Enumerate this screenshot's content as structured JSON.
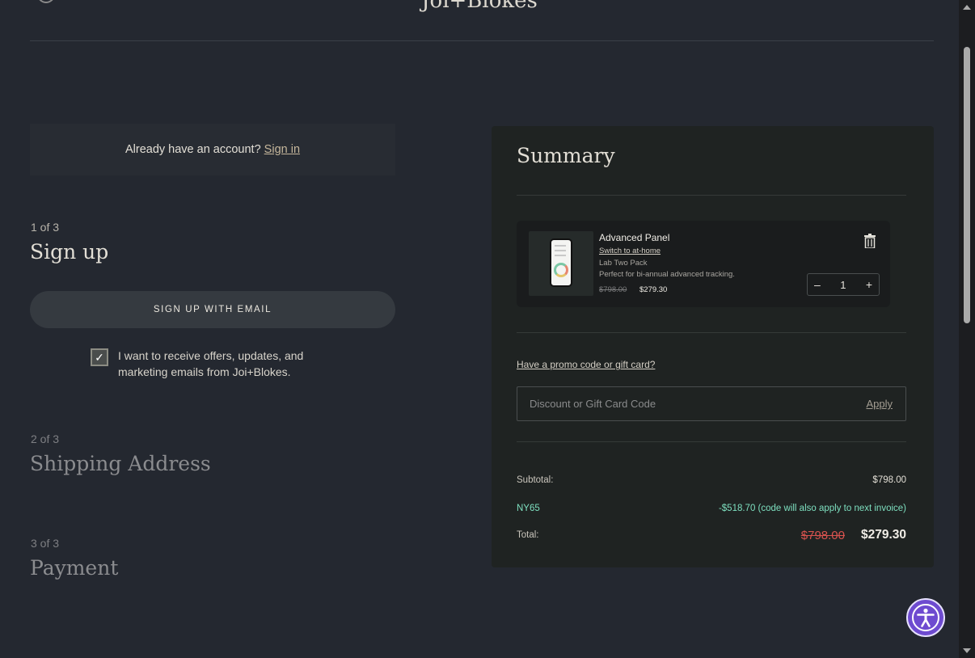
{
  "header": {
    "brand": "Joi+Blokes"
  },
  "account": {
    "prompt": "Already have an account?",
    "sign_in": "Sign in"
  },
  "steps": [
    {
      "count": "1 of 3",
      "title": "Sign up"
    },
    {
      "count": "2 of 3",
      "title": "Shipping Address"
    },
    {
      "count": "3 of 3",
      "title": "Payment"
    }
  ],
  "signup": {
    "button_label": "SIGN UP WITH EMAIL",
    "optin_checked": true,
    "optin_text": "I want to receive offers, updates, and marketing emails from Joi+Blokes.",
    "check_glyph": "✓"
  },
  "summary": {
    "title": "Summary",
    "item": {
      "name": "Advanced Panel",
      "switch_link": "Switch to at-home",
      "variant": "Lab Two Pack",
      "description": "Perfect for bi-annual advanced tracking.",
      "old_price": "$798.00",
      "price": "$279.30",
      "quantity": "1",
      "minus": "–",
      "plus": "+"
    },
    "promo": {
      "link": "Have a promo code or gift card?",
      "placeholder": "Discount or Gift Card Code",
      "apply": "Apply"
    },
    "subtotal_label": "Subtotal:",
    "subtotal_value": "$798.00",
    "code_label": "NY65",
    "code_value": "-$518.70 (code will also apply to next invoice)",
    "total_label": "Total:",
    "total_old": "$798.00",
    "total_new": "$279.30"
  },
  "colors": {
    "background": "#242830",
    "panel": "#1f2322",
    "accent_code": "#7ee0c0",
    "strike_red": "#d9534f",
    "a11y_purple": "#6e4bd0"
  }
}
